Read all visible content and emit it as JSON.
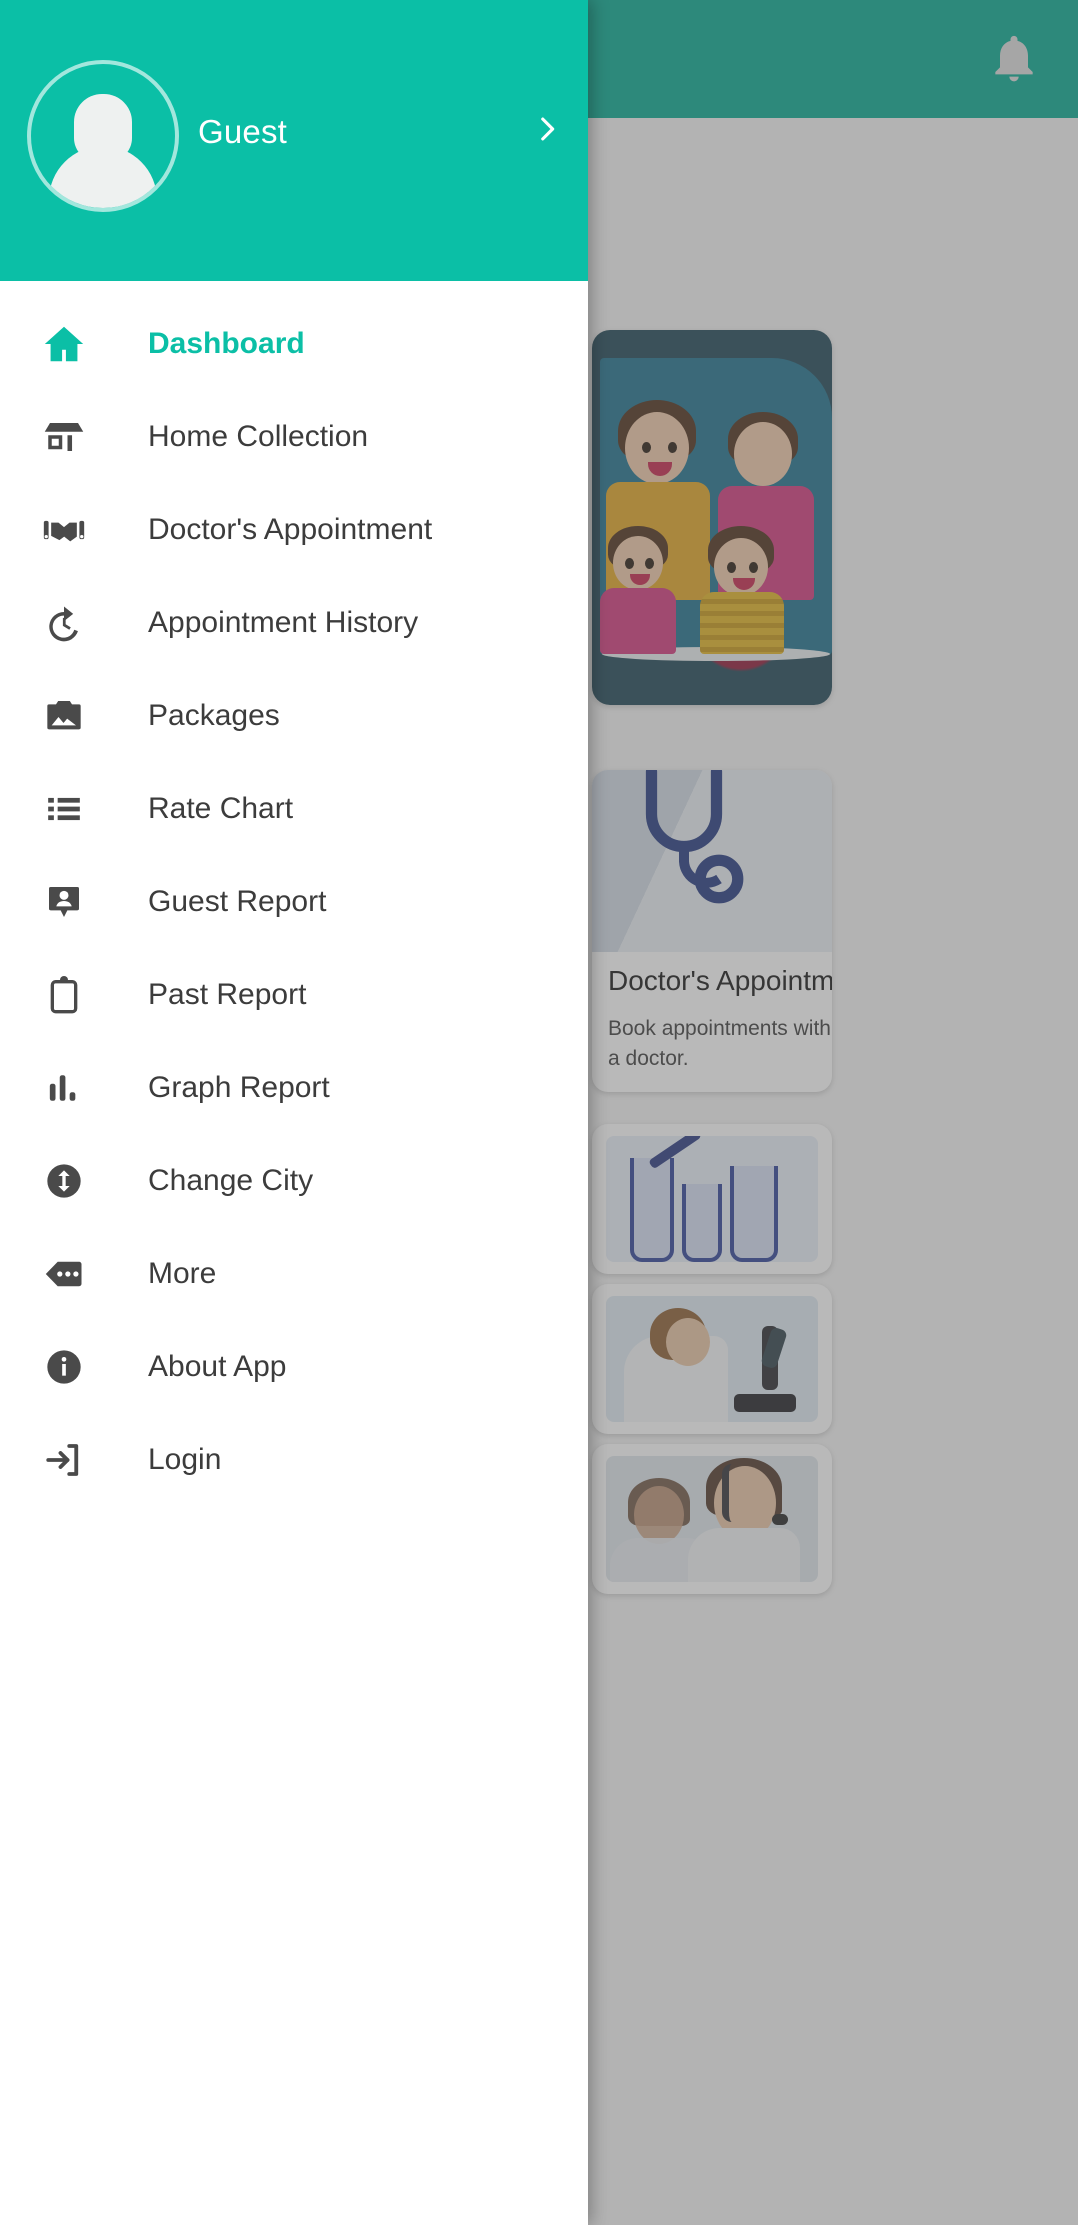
{
  "app_bar": {
    "notification_icon": "bell-icon"
  },
  "drawer": {
    "profile": {
      "name": "Guest",
      "avatar_icon": "person-avatar-icon",
      "chevron_icon": "chevron-right-icon"
    },
    "items": [
      {
        "label": "Dashboard",
        "icon": "home-icon",
        "active": true
      },
      {
        "label": "Home Collection",
        "icon": "store-icon",
        "active": false
      },
      {
        "label": "Doctor's Appointment",
        "icon": "handshake-icon",
        "active": false
      },
      {
        "label": "Appointment History",
        "icon": "history-icon",
        "active": false
      },
      {
        "label": "Packages",
        "icon": "photo-icon",
        "active": false
      },
      {
        "label": "Rate Chart",
        "icon": "list-icon",
        "active": false
      },
      {
        "label": "Guest Report",
        "icon": "contact-badge-icon",
        "active": false
      },
      {
        "label": "Past Report",
        "icon": "clipboard-icon",
        "active": false
      },
      {
        "label": "Graph Report",
        "icon": "bar-chart-icon",
        "active": false
      },
      {
        "label": "Change City",
        "icon": "sync-circle-icon",
        "active": false
      },
      {
        "label": "More",
        "icon": "more-tag-icon",
        "active": false
      },
      {
        "label": "About App",
        "icon": "info-circle-icon",
        "active": false
      },
      {
        "label": "Login",
        "icon": "login-arrow-icon",
        "active": false
      }
    ]
  },
  "background": {
    "banner": {
      "image": "cartoon-family-illustration"
    },
    "doctor_card": {
      "title": "Doctor's Appointment",
      "subtitle": "Book appointments with a doctor.",
      "image": "stethoscope-doctor-coat"
    },
    "thumbnails": [
      {
        "image": "test-tubes-lab"
      },
      {
        "image": "microscope-technician"
      },
      {
        "image": "customer-support-headset"
      }
    ]
  },
  "colors": {
    "primary": "#0bbfa6",
    "appbar": "#00a88e",
    "icon_default": "#4a4a4a",
    "text_default": "#3c3c3c",
    "scrim": "rgba(100,100,100,0.45)"
  }
}
